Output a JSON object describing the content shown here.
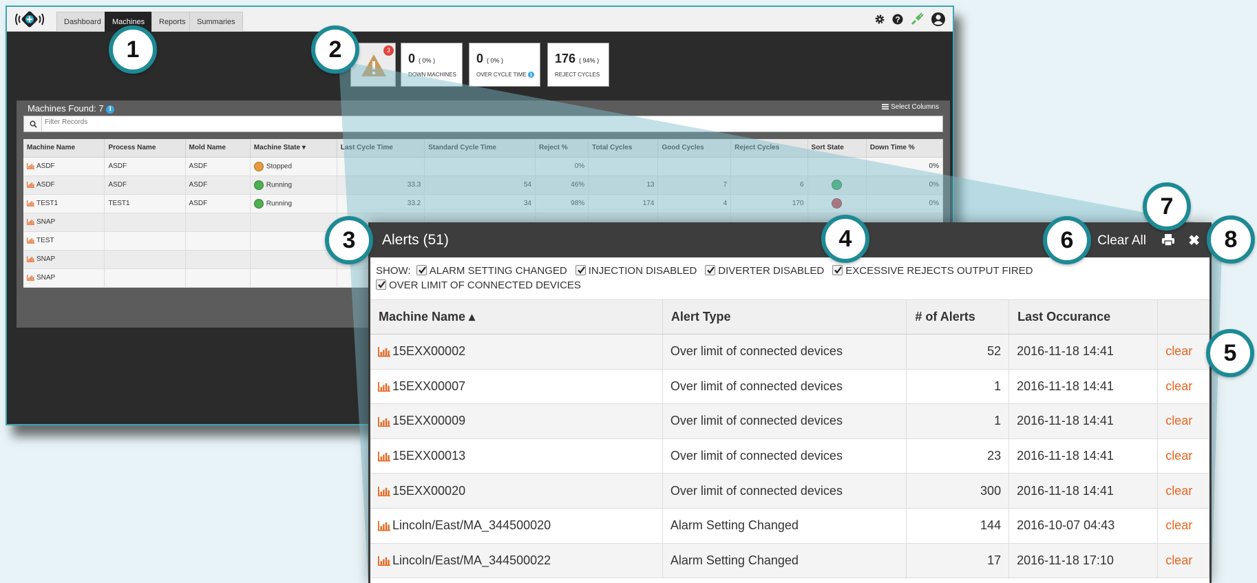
{
  "nav": {
    "tabs": [
      "Dashboard",
      "Machines",
      "Reports",
      "Summaries"
    ],
    "active": "Machines"
  },
  "topbar_icons": [
    "gear-icon",
    "help-icon",
    "plug-icon",
    "user-icon"
  ],
  "stats": {
    "alert_badge": "3",
    "down": {
      "value": "0",
      "pct": "( 0% )",
      "label": "DOWN MACHINES"
    },
    "overcycle": {
      "value": "0",
      "pct": "( 0% )",
      "label": "OVER CYCLE TIME"
    },
    "reject": {
      "value": "176",
      "pct": "( 94% )",
      "label": "REJECT CYCLES"
    }
  },
  "machines": {
    "found_label": "Machines Found: 7",
    "select_columns": "Select Columns",
    "filter_placeholder": "Filter Records",
    "columns": [
      "Machine Name",
      "Process Name",
      "Mold Name",
      "Machine State",
      "Last Cycle Time",
      "Standard Cycle Time",
      "Reject %",
      "Total Cycles",
      "Good Cycles",
      "Reject Cycles",
      "Sort State",
      "Down Time %"
    ],
    "rows": [
      {
        "name": "ASDF",
        "process": "ASDF",
        "mold": "ASDF",
        "state": "Stopped",
        "last": "",
        "standard": "",
        "reject_pct": "0%",
        "total": "",
        "good": "",
        "reject": "",
        "sort": "",
        "down": "0%"
      },
      {
        "name": "ASDF",
        "process": "ASDF",
        "mold": "ASDF",
        "state": "Running",
        "last": "33.3",
        "standard": "54",
        "reject_pct": "46%",
        "total": "13",
        "good": "7",
        "reject": "6",
        "sort": "green",
        "down": "0%"
      },
      {
        "name": "TEST1",
        "process": "TEST1",
        "mold": "ASDF",
        "state": "Running",
        "last": "33.2",
        "standard": "34",
        "reject_pct": "98%",
        "total": "174",
        "good": "4",
        "reject": "170",
        "sort": "red",
        "down": "0%"
      },
      {
        "name": "SNAP",
        "process": "",
        "mold": "",
        "state": "",
        "last": "",
        "standard": "",
        "reject_pct": "",
        "total": "",
        "good": "",
        "reject": "",
        "sort": "",
        "down": ""
      },
      {
        "name": "TEST",
        "process": "",
        "mold": "",
        "state": "",
        "last": "",
        "standard": "",
        "reject_pct": "",
        "total": "",
        "good": "",
        "reject": "",
        "sort": "",
        "down": ""
      },
      {
        "name": "SNAP",
        "process": "",
        "mold": "",
        "state": "",
        "last": "",
        "standard": "",
        "reject_pct": "",
        "total": "",
        "good": "",
        "reject": "",
        "sort": "",
        "down": ""
      },
      {
        "name": "SNAP",
        "process": "",
        "mold": "",
        "state": "",
        "last": "",
        "standard": "",
        "reject_pct": "",
        "total": "",
        "good": "",
        "reject": "",
        "sort": "",
        "down": ""
      }
    ]
  },
  "alerts": {
    "title": "Alerts (51)",
    "clear_all": "Clear All",
    "show_label": "SHOW:",
    "filters": [
      "ALARM SETTING CHANGED",
      "INJECTION DISABLED",
      "DIVERTER DISABLED",
      "EXCESSIVE REJECTS OUTPUT FIRED",
      "OVER LIMIT OF CONNECTED DEVICES"
    ],
    "columns": [
      "Machine Name ▴",
      "Alert Type",
      "# of Alerts",
      "Last Occurance",
      ""
    ],
    "clear_label": "clear",
    "rows": [
      {
        "machine": "15EXX00002",
        "type": "Over limit of connected devices",
        "count": "52",
        "last": "2016-11-18 14:41"
      },
      {
        "machine": "15EXX00007",
        "type": "Over limit of connected devices",
        "count": "1",
        "last": "2016-11-18 14:41"
      },
      {
        "machine": "15EXX00009",
        "type": "Over limit of connected devices",
        "count": "1",
        "last": "2016-11-18 14:41"
      },
      {
        "machine": "15EXX00013",
        "type": "Over limit of connected devices",
        "count": "23",
        "last": "2016-11-18 14:41"
      },
      {
        "machine": "15EXX00020",
        "type": "Over limit of connected devices",
        "count": "300",
        "last": "2016-11-18 14:41"
      },
      {
        "machine": "Lincoln/East/MA_344500020",
        "type": "Alarm Setting Changed",
        "count": "144",
        "last": "2016-10-07 04:43"
      },
      {
        "machine": "Lincoln/East/MA_344500022",
        "type": "Alarm Setting Changed",
        "count": "17",
        "last": "2016-11-18 17:10"
      }
    ]
  },
  "callouts": [
    "1",
    "2",
    "3",
    "4",
    "5",
    "6",
    "7",
    "8"
  ],
  "colors": {
    "callout_ring": "#1d8a95",
    "clear_link": "#e8641e",
    "chart_icon": "#e8641e",
    "running": "#4caf50",
    "stopped": "#e69a3a",
    "sort_green": "#3aa860",
    "sort_red": "#c9404a"
  }
}
